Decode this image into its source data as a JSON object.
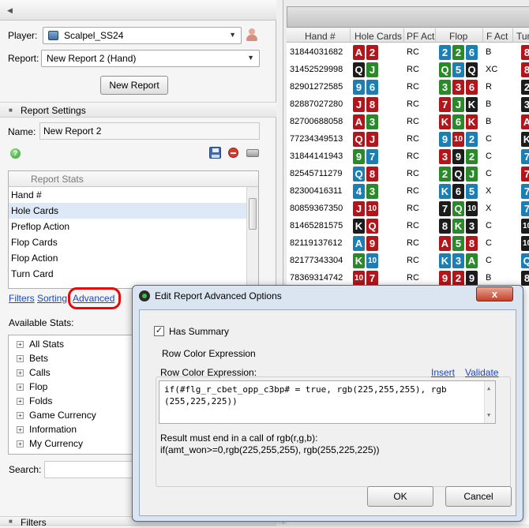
{
  "left_panel": {
    "collapse_icon": "triangle-left-icon",
    "player_label": "Player:",
    "player_value": "Scalpel_SS24",
    "report_label": "Report:",
    "report_value": "New Report 2 (Hand)",
    "new_report_button": "New Report",
    "report_settings_header": "Report Settings",
    "name_label": "Name:",
    "name_value": "New Report 2",
    "report_stats_header": "Report Stats",
    "report_stats": [
      "Hand #",
      "Hole Cards",
      "Preflop Action",
      "Flop Cards",
      "Flop Action",
      "Turn Card"
    ],
    "links": {
      "filters": "Filters",
      "sorting": "Sorting",
      "advanced": "Advanced"
    },
    "available_stats_label": "Available Stats:",
    "available_stats": [
      "All Stats",
      "Bets",
      "Calls",
      "Flop",
      "Folds",
      "Game Currency",
      "Information",
      "My Currency"
    ],
    "search_label": "Search:",
    "filters_section": "Filters"
  },
  "grid": {
    "columns": [
      "Hand #",
      "Hole Cards",
      "PF Act",
      "Flop",
      "F Act",
      "Tur"
    ],
    "rows": [
      {
        "hand": "31844031682",
        "hole": [
          [
            "A",
            2
          ],
          [
            "2",
            2
          ]
        ],
        "pf": "RC",
        "flop": [
          [
            "2",
            1
          ],
          [
            "2",
            3
          ],
          [
            "6",
            1
          ]
        ],
        "fact": "B",
        "turn": [
          "8",
          2
        ]
      },
      {
        "hand": "31452529998",
        "hole": [
          [
            "Q",
            0
          ],
          [
            "J",
            3
          ]
        ],
        "pf": "RC",
        "flop": [
          [
            "Q",
            3
          ],
          [
            "5",
            1
          ],
          [
            "Q",
            0
          ]
        ],
        "fact": "XC",
        "turn": [
          "8",
          2
        ]
      },
      {
        "hand": "82901272585",
        "hole": [
          [
            "9",
            1
          ],
          [
            "6",
            1
          ]
        ],
        "pf": "RC",
        "flop": [
          [
            "3",
            3
          ],
          [
            "3",
            2
          ],
          [
            "6",
            2
          ]
        ],
        "fact": "R",
        "turn": [
          "2",
          0
        ]
      },
      {
        "hand": "82887027280",
        "hole": [
          [
            "J",
            2
          ],
          [
            "8",
            2
          ]
        ],
        "pf": "RC",
        "flop": [
          [
            "7",
            2
          ],
          [
            "J",
            3
          ],
          [
            "K",
            0
          ]
        ],
        "fact": "B",
        "turn": [
          "3",
          0
        ]
      },
      {
        "hand": "82700688058",
        "hole": [
          [
            "A",
            2
          ],
          [
            "3",
            3
          ]
        ],
        "pf": "RC",
        "flop": [
          [
            "K",
            2
          ],
          [
            "6",
            3
          ],
          [
            "K",
            2
          ]
        ],
        "fact": "B",
        "turn": [
          "A",
          2
        ]
      },
      {
        "hand": "77234349513",
        "hole": [
          [
            "Q",
            2
          ],
          [
            "J",
            2
          ]
        ],
        "pf": "RC",
        "flop": [
          [
            "9",
            1
          ],
          [
            "10",
            2
          ],
          [
            "2",
            1
          ]
        ],
        "fact": "C",
        "turn": [
          "K",
          0
        ]
      },
      {
        "hand": "31844141943",
        "hole": [
          [
            "9",
            3
          ],
          [
            "7",
            1
          ]
        ],
        "pf": "RC",
        "flop": [
          [
            "3",
            2
          ],
          [
            "9",
            0
          ],
          [
            "2",
            3
          ]
        ],
        "fact": "C",
        "turn": [
          "7",
          1
        ]
      },
      {
        "hand": "82545711279",
        "hole": [
          [
            "Q",
            1
          ],
          [
            "8",
            2
          ]
        ],
        "pf": "RC",
        "flop": [
          [
            "2",
            3
          ],
          [
            "Q",
            0
          ],
          [
            "J",
            3
          ]
        ],
        "fact": "C",
        "turn": [
          "7",
          2
        ]
      },
      {
        "hand": "82300416311",
        "hole": [
          [
            "4",
            1
          ],
          [
            "3",
            3
          ]
        ],
        "pf": "RC",
        "flop": [
          [
            "K",
            1
          ],
          [
            "6",
            0
          ],
          [
            "5",
            1
          ]
        ],
        "fact": "X",
        "turn": [
          "7",
          1
        ]
      },
      {
        "hand": "80859367350",
        "hole": [
          [
            "J",
            2
          ],
          [
            "10",
            2
          ]
        ],
        "pf": "RC",
        "flop": [
          [
            "7",
            0
          ],
          [
            "Q",
            3
          ],
          [
            "10",
            0
          ]
        ],
        "fact": "X",
        "turn": [
          "7",
          1
        ]
      },
      {
        "hand": "81465281575",
        "hole": [
          [
            "K",
            0
          ],
          [
            "Q",
            2
          ]
        ],
        "pf": "RC",
        "flop": [
          [
            "8",
            0
          ],
          [
            "K",
            3
          ],
          [
            "3",
            0
          ]
        ],
        "fact": "C",
        "turn": [
          "10",
          0
        ]
      },
      {
        "hand": "82119137612",
        "hole": [
          [
            "A",
            1
          ],
          [
            "9",
            2
          ]
        ],
        "pf": "RC",
        "flop": [
          [
            "A",
            2
          ],
          [
            "5",
            3
          ],
          [
            "8",
            2
          ]
        ],
        "fact": "C",
        "turn": [
          "10",
          0
        ]
      },
      {
        "hand": "82177343304",
        "hole": [
          [
            "K",
            3
          ],
          [
            "10",
            1
          ]
        ],
        "pf": "RC",
        "flop": [
          [
            "K",
            1
          ],
          [
            "3",
            1
          ],
          [
            "A",
            3
          ]
        ],
        "fact": "C",
        "turn": [
          "Q",
          1
        ]
      },
      {
        "hand": "78369314742",
        "hole": [
          [
            "10",
            2
          ],
          [
            "7",
            2
          ]
        ],
        "pf": "RC",
        "flop": [
          [
            "9",
            2
          ],
          [
            "2",
            2
          ],
          [
            "9",
            0
          ]
        ],
        "fact": "B",
        "turn": [
          "8",
          0
        ]
      }
    ],
    "suit_colors": [
      "#1c1c1c",
      "#1a7fb5",
      "#b3151b",
      "#2a8a2a"
    ]
  },
  "dialog": {
    "title": "Edit Report Advanced Options",
    "close_label": "x",
    "has_summary_label": "Has Summary",
    "has_summary_checked": "✓",
    "group_label": "Row Color Expression",
    "field_label": "Row Color Expression:",
    "insert_link": "Insert",
    "validate_link": "Validate",
    "expression": "if(#flg_r_cbet_opp_c3bp# = true, rgb(225,255,255), rgb (255,225,225))",
    "hint_line1": "Result must end in a call of rgb(r,g,b):",
    "hint_line2": "if(amt_won>=0,rgb(225,255,255), rgb(255,225,225))",
    "ok_button": "OK",
    "cancel_button": "Cancel"
  }
}
